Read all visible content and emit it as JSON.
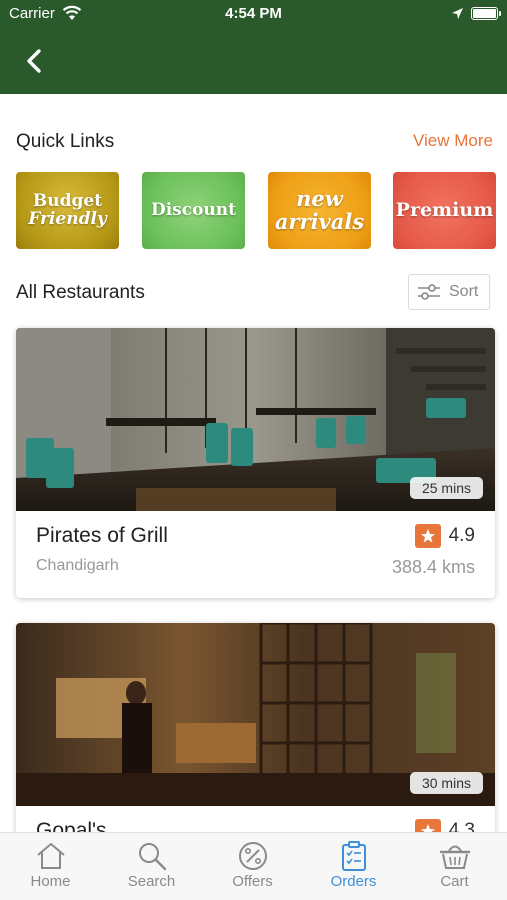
{
  "status_bar": {
    "carrier": "Carrier",
    "time": "4:54 PM"
  },
  "nav": {
    "back_icon": "chevron-left-icon"
  },
  "quick_links": {
    "title": "Quick Links",
    "view_more": "View More",
    "items": [
      {
        "line1": "Budget",
        "line2": "Friendly",
        "color": "#c4a51f"
      },
      {
        "line1": "Discount",
        "line2": "",
        "color": "#74c664"
      },
      {
        "line1": "new",
        "line2": "arrivals",
        "color": "#f0a51d"
      },
      {
        "line1": "Premium",
        "line2": "",
        "color": "#e4604e"
      }
    ]
  },
  "restaurants": {
    "title": "All Restaurants",
    "sort_label": "Sort",
    "items": [
      {
        "name": "Pirates of Grill",
        "city": "Chandigarh",
        "rating": "4.9",
        "distance": "388.4 kms",
        "delivery_time": "25 mins"
      },
      {
        "name": "Gopal's",
        "city": "",
        "rating": "4.3",
        "distance": "",
        "delivery_time": "30 mins"
      }
    ]
  },
  "tab_bar": {
    "active": "Orders",
    "active_color": "#3d8fd9",
    "tabs": [
      {
        "label": "Home",
        "icon": "home-icon"
      },
      {
        "label": "Search",
        "icon": "search-icon"
      },
      {
        "label": "Offers",
        "icon": "percent-icon"
      },
      {
        "label": "Orders",
        "icon": "clipboard-icon"
      },
      {
        "label": "Cart",
        "icon": "basket-icon"
      }
    ]
  },
  "colors": {
    "header": "#2a5a2c",
    "accent": "#e8753a"
  }
}
